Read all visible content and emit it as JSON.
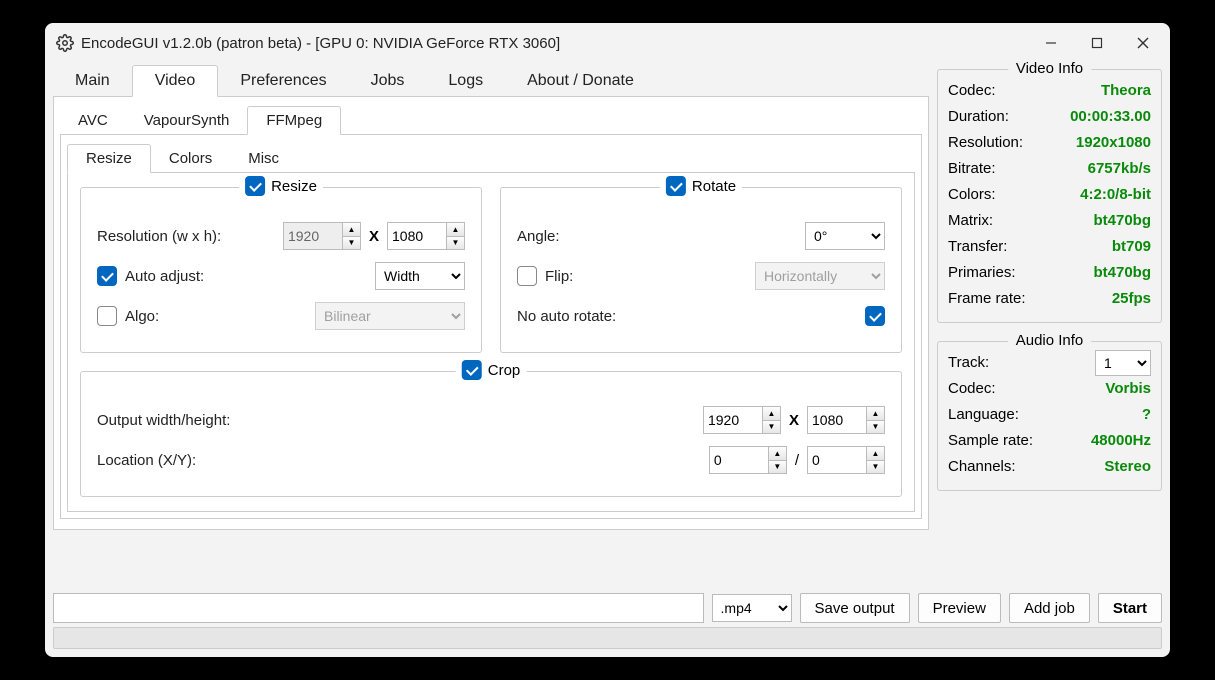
{
  "window": {
    "title": "EncodeGUI v1.2.0b (patron beta) - [GPU 0: NVIDIA GeForce RTX 3060]"
  },
  "mainTabs": [
    "Main",
    "Video",
    "Preferences",
    "Jobs",
    "Logs",
    "About / Donate"
  ],
  "subTabs": [
    "AVC",
    "VapourSynth",
    "FFMpeg"
  ],
  "sub2Tabs": [
    "Resize",
    "Colors",
    "Misc"
  ],
  "resize": {
    "header": "Resize",
    "res_label": "Resolution (w x h):",
    "w": "1920",
    "h": "1080",
    "autoadjust_label": "Auto adjust:",
    "autoadjust_value": "Width",
    "algo_label": "Algo:",
    "algo_value": "Bilinear"
  },
  "rotate": {
    "header": "Rotate",
    "angle_label": "Angle:",
    "angle_value": "0°",
    "flip_label": "Flip:",
    "flip_value": "Horizontally",
    "noauto_label": "No auto rotate:"
  },
  "crop": {
    "header": "Crop",
    "out_label": "Output width/height:",
    "out_w": "1920",
    "out_h": "1080",
    "loc_label": "Location (X/Y):",
    "loc_x": "0",
    "loc_y": "0"
  },
  "bottom": {
    "ext": ".mp4",
    "save": "Save output",
    "preview": "Preview",
    "addjob": "Add job",
    "start": "Start"
  },
  "videoInfo": {
    "title": "Video Info",
    "rows": {
      "codec_l": "Codec:",
      "codec_v": "Theora",
      "dur_l": "Duration:",
      "dur_v": "00:00:33.00",
      "res_l": "Resolution:",
      "res_v": "1920x1080",
      "bit_l": "Bitrate:",
      "bit_v": "6757kb/s",
      "col_l": "Colors:",
      "col_v": "4:2:0/8-bit",
      "mat_l": "Matrix:",
      "mat_v": "bt470bg",
      "tra_l": "Transfer:",
      "tra_v": "bt709",
      "pri_l": "Primaries:",
      "pri_v": "bt470bg",
      "fps_l": "Frame rate:",
      "fps_v": "25fps"
    }
  },
  "audioInfo": {
    "title": "Audio Info",
    "track_l": "Track:",
    "track_v": "1",
    "codec_l": "Codec:",
    "codec_v": "Vorbis",
    "lang_l": "Language:",
    "lang_v": "?",
    "sr_l": "Sample rate:",
    "sr_v": "48000Hz",
    "ch_l": "Channels:",
    "ch_v": "Stereo"
  }
}
